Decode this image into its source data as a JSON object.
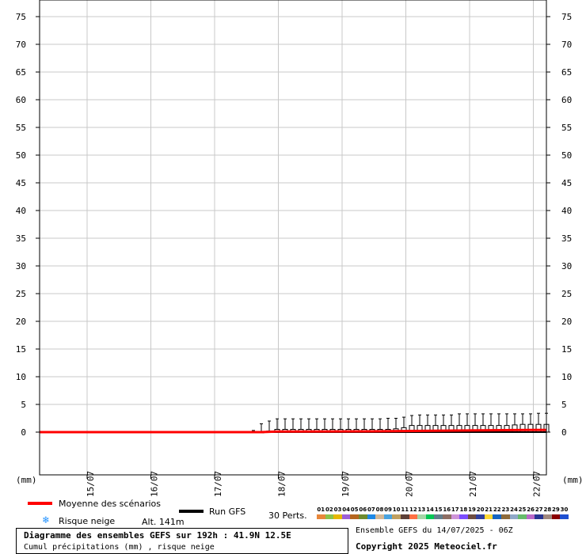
{
  "chart_data": {
    "type": "line",
    "title": "Diagramme des ensembles GEFS sur 192h : 41.9N 12.5E",
    "subtitle": "Cumul précipitations (mm) , risque neige",
    "ylabel_left": "(mm)",
    "ylabel_right": "(mm)",
    "ylim": [
      -8.5,
      78
    ],
    "yticks": [
      0,
      5,
      10,
      15,
      20,
      25,
      30,
      35,
      40,
      45,
      50,
      55,
      60,
      65,
      70,
      75
    ],
    "xlim": [
      "2025-07-14T06:00",
      "2025-07-22T06:00"
    ],
    "xticks": [
      "15/07",
      "16/07",
      "17/07",
      "18/07",
      "19/07",
      "20/07",
      "21/07",
      "22/07"
    ],
    "grid": true,
    "series": [
      {
        "name": "Moyenne des scénarios",
        "color": "#ff0000",
        "x": [
          "2025-07-14T06:00",
          "2025-07-17T18:00",
          "2025-07-18T00:00",
          "2025-07-19T12:00",
          "2025-07-20T00:00",
          "2025-07-21T00:00",
          "2025-07-22T00:00",
          "2025-07-22T06:00"
        ],
        "y": [
          0,
          0,
          0.1,
          0.15,
          0.2,
          0.3,
          0.4,
          0.4
        ]
      },
      {
        "name": "Run GFS",
        "color": "#000000",
        "x": [
          "2025-07-14T06:00",
          "2025-07-22T06:00"
        ],
        "y": [
          0,
          0
        ]
      }
    ],
    "boxes": {
      "times": [
        "2025-07-17T15:00",
        "2025-07-17T18:00",
        "2025-07-17T21:00",
        "2025-07-18T00:00",
        "2025-07-18T03:00",
        "2025-07-18T06:00",
        "2025-07-18T09:00",
        "2025-07-18T12:00",
        "2025-07-18T15:00",
        "2025-07-18T18:00",
        "2025-07-18T21:00",
        "2025-07-19T00:00",
        "2025-07-19T03:00",
        "2025-07-19T06:00",
        "2025-07-19T09:00",
        "2025-07-19T12:00",
        "2025-07-19T15:00",
        "2025-07-19T18:00",
        "2025-07-19T21:00",
        "2025-07-20T00:00",
        "2025-07-20T03:00",
        "2025-07-20T06:00",
        "2025-07-20T09:00",
        "2025-07-20T12:00",
        "2025-07-20T15:00",
        "2025-07-20T18:00",
        "2025-07-20T21:00",
        "2025-07-21T00:00",
        "2025-07-21T03:00",
        "2025-07-21T06:00",
        "2025-07-21T09:00",
        "2025-07-21T12:00",
        "2025-07-21T15:00",
        "2025-07-21T18:00",
        "2025-07-21T21:00",
        "2025-07-22T00:00",
        "2025-07-22T03:00",
        "2025-07-22T06:00"
      ],
      "max": [
        0.3,
        1.5,
        2.0,
        2.4,
        2.4,
        2.4,
        2.4,
        2.4,
        2.4,
        2.4,
        2.4,
        2.4,
        2.4,
        2.4,
        2.4,
        2.4,
        2.4,
        2.5,
        2.5,
        2.7,
        3.0,
        3.1,
        3.1,
        3.1,
        3.1,
        3.1,
        3.3,
        3.3,
        3.3,
        3.3,
        3.3,
        3.3,
        3.3,
        3.3,
        3.3,
        3.3,
        3.4,
        3.4
      ],
      "q75": [
        0.0,
        0.0,
        0.2,
        0.5,
        0.5,
        0.5,
        0.5,
        0.5,
        0.5,
        0.5,
        0.5,
        0.5,
        0.5,
        0.5,
        0.5,
        0.5,
        0.5,
        0.5,
        0.6,
        0.8,
        1.2,
        1.2,
        1.2,
        1.2,
        1.2,
        1.2,
        1.2,
        1.2,
        1.2,
        1.2,
        1.2,
        1.2,
        1.2,
        1.3,
        1.4,
        1.4,
        1.4,
        1.4
      ],
      "q25": [
        0,
        0,
        0,
        0,
        0,
        0,
        0,
        0,
        0,
        0,
        0,
        0,
        0,
        0,
        0,
        0,
        0,
        0,
        0,
        0,
        0,
        0,
        0,
        0,
        0,
        0,
        0,
        0,
        0,
        0,
        0,
        0,
        0,
        0,
        0,
        0,
        0,
        0
      ],
      "min": [
        0,
        0,
        0,
        0,
        0,
        0,
        0,
        0,
        0,
        0,
        0,
        0,
        0,
        0,
        0,
        0,
        0,
        0,
        0,
        0,
        0,
        0,
        0,
        0,
        0,
        0,
        0,
        0,
        0,
        0,
        0,
        0,
        0,
        0,
        0,
        0,
        0,
        0
      ]
    }
  },
  "legend": {
    "mean_label": "Moyenne des scénarios",
    "mean_color": "#ff0000",
    "gfs_label": "Run GFS",
    "gfs_color": "#000000",
    "snow_label": "Risque neige",
    "snow_icon": "snowflake-icon",
    "altitude": "Alt. 141m",
    "perts_label": "30 Perts."
  },
  "perturbations": {
    "labels": [
      "01",
      "02",
      "03",
      "04",
      "05",
      "06",
      "07",
      "08",
      "09",
      "10",
      "11",
      "12",
      "13",
      "14",
      "15",
      "16",
      "17",
      "18",
      "19",
      "20",
      "21",
      "22",
      "23",
      "24",
      "25",
      "26",
      "27",
      "28",
      "29",
      "30"
    ],
    "colors": [
      "#e8873a",
      "#8bc34a",
      "#e6b800",
      "#9c5fd6",
      "#b5651d",
      "#6d8b2f",
      "#1e88e5",
      "#d4b896",
      "#4aa3df",
      "#c0a060",
      "#5d4037",
      "#ff7043",
      "#a5d6a7",
      "#00c853",
      "#607d8b",
      "#8d6e63",
      "#ce93d8",
      "#7c4dff",
      "#6d4c41",
      "#303f9f",
      "#fdd835",
      "#1565c0",
      "#8e6b3a",
      "#8fa8c8",
      "#66bb6a",
      "#ba68c8",
      "#283593",
      "#a1887f",
      "#8b0000",
      "#1e4fd1"
    ]
  },
  "footer": {
    "title": "Diagramme des ensembles GEFS sur 192h : 41.9N 12.5E",
    "subtitle": "Cumul précipitations (mm) , risque neige",
    "run": "Ensemble GEFS du 14/07/2025 - 06Z",
    "copyright": "Copyright 2025 Meteociel.fr"
  }
}
